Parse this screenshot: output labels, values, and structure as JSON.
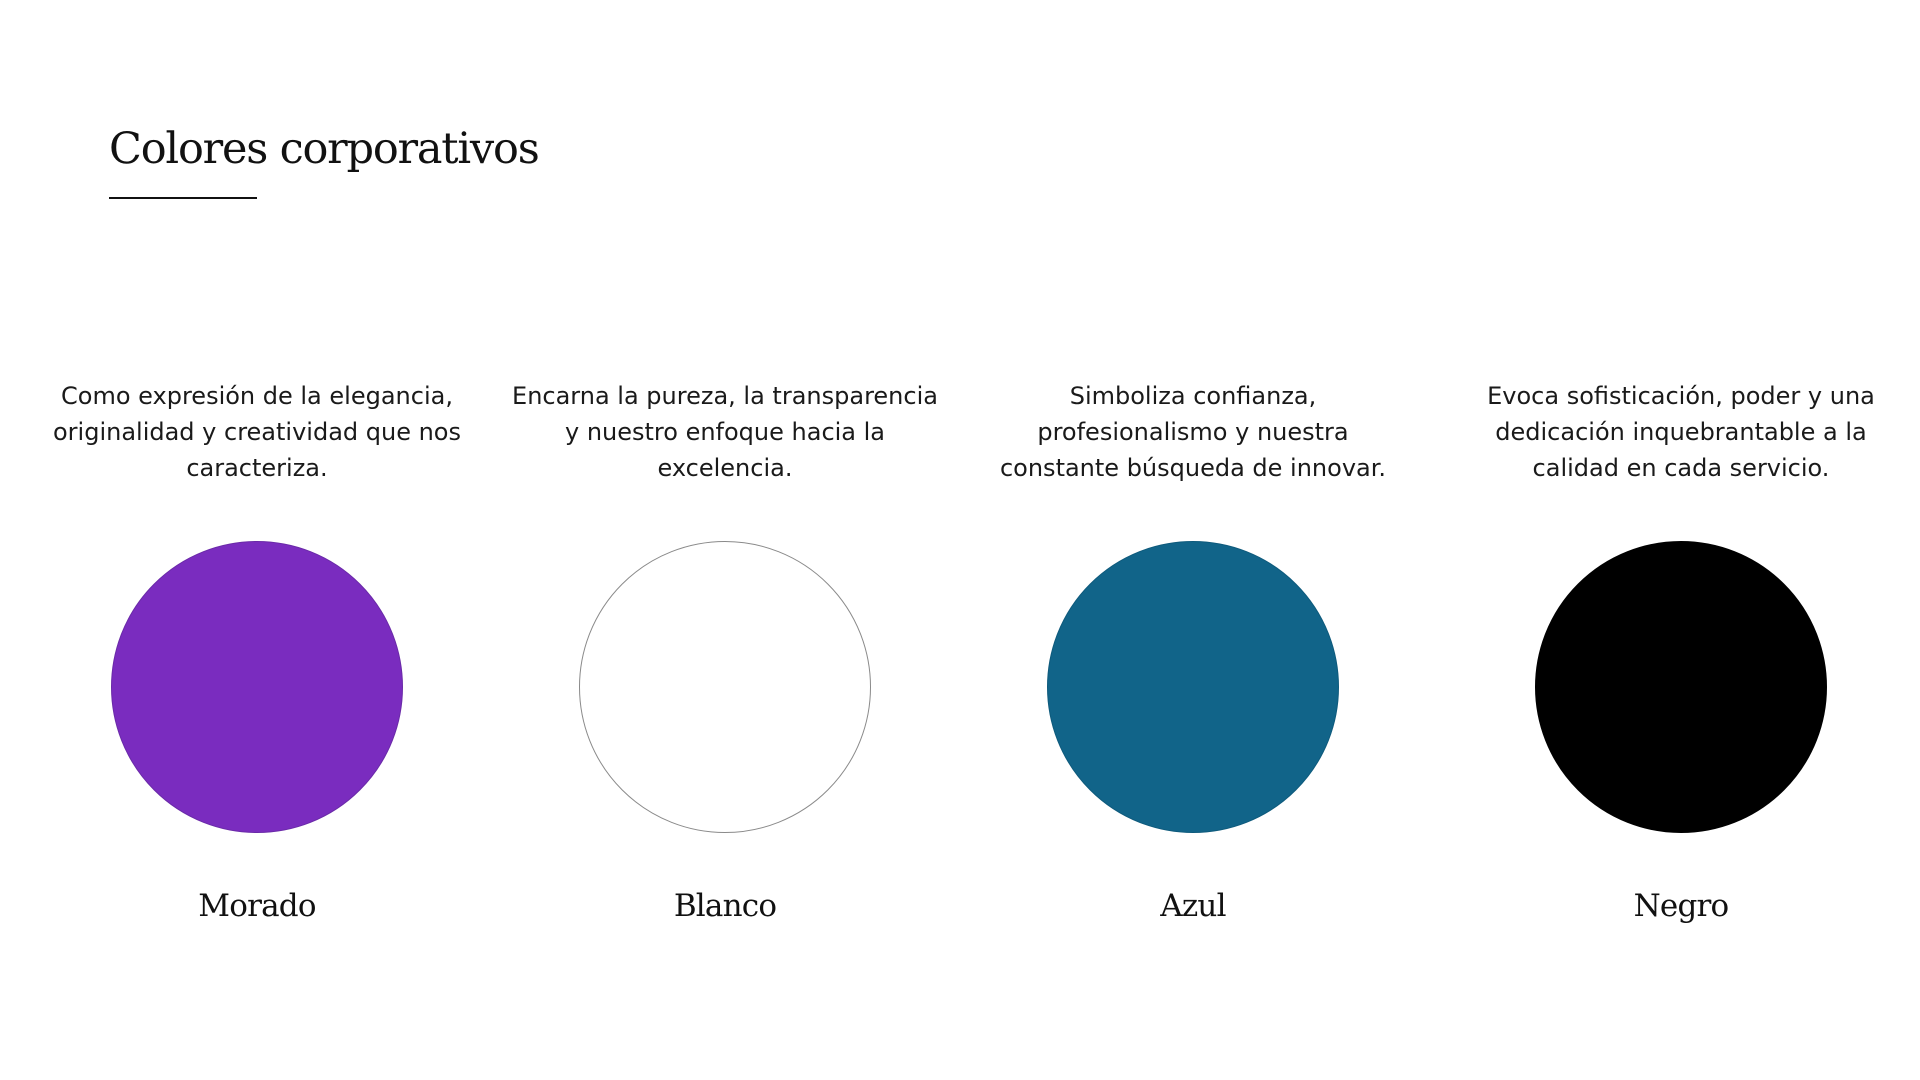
{
  "header": {
    "title": "Colores corporativos"
  },
  "swatches": [
    {
      "name": "Morado",
      "description": "Como expresión de la elegancia, originalidad y creatividad que nos caracteriza.",
      "color": "#7a2cbf",
      "border": "#6a2aa8"
    },
    {
      "name": "Blanco",
      "description": "Encarna la pureza, la transparencia y nuestro enfoque hacia la excelencia.",
      "color": "#ffffff",
      "border": "#8a8a8a"
    },
    {
      "name": "Azul",
      "description": "Simboliza confianza, profesionalismo y nuestra constante búsqueda de innovar.",
      "color": "#116489",
      "border": "#0e5a7c"
    },
    {
      "name": "Negro",
      "description": "Evoca sofisticación, poder y una dedicación inquebrantable a la calidad en cada servicio.",
      "color": "#000000",
      "border": "#000000"
    }
  ]
}
